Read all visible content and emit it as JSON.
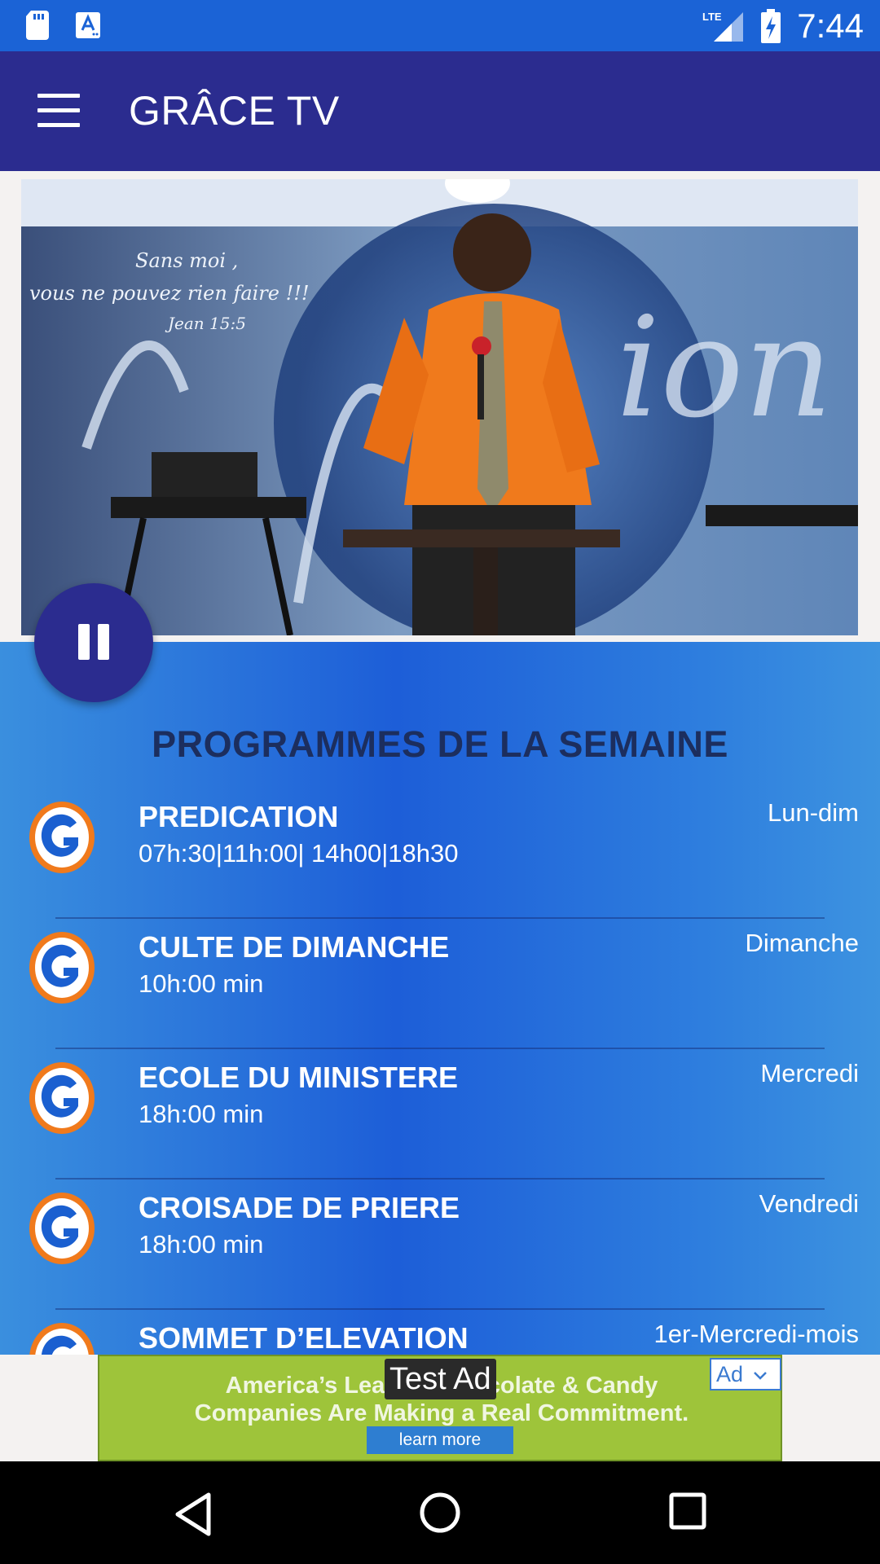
{
  "status_bar": {
    "time": "7:44",
    "network": "LTE",
    "icons": [
      "sd-card-icon",
      "a-notification-icon",
      "signal-icon",
      "battery-charging-icon"
    ]
  },
  "app_bar": {
    "title": "GRÂCE TV",
    "menu_icon": "hamburger-menu-icon"
  },
  "video": {
    "state": "playing",
    "control_icon": "pause-icon",
    "overlay_text": [
      "Sans moi ,",
      "vous ne pouvez rien faire !!!",
      "Jean 15:5"
    ]
  },
  "programs": {
    "title": "PROGRAMMES DE LA SEMAINE",
    "items": [
      {
        "name": "PREDICATION",
        "time": "07h:30|11h:00| 14h00|18h30",
        "day": "Lun-dim"
      },
      {
        "name": "CULTE DE DIMANCHE",
        "time": "10h:00 min",
        "day": "Dimanche"
      },
      {
        "name": "ECOLE DU MINISTERE",
        "time": "18h:00 min",
        "day": "Mercredi"
      },
      {
        "name": "CROISADE DE PRIERE",
        "time": "18h:00 min",
        "day": "Vendredi"
      },
      {
        "name": "SOMMET D’ELEVATION",
        "time": "",
        "day": "1er-Mercredi-mois"
      }
    ]
  },
  "ad": {
    "test_label": "Test Ad",
    "line1": "America’s Leading Chocolate & Candy",
    "line2": "Companies Are Making a Real Commitment.",
    "cta": "learn more",
    "badge": "Ad"
  },
  "colors": {
    "status_bar": "#1b63d6",
    "app_bar": "#2b2c8f",
    "section_title": "#1c2e5e",
    "logo_orange": "#f07a1c",
    "logo_blue": "#1a5fd0"
  }
}
